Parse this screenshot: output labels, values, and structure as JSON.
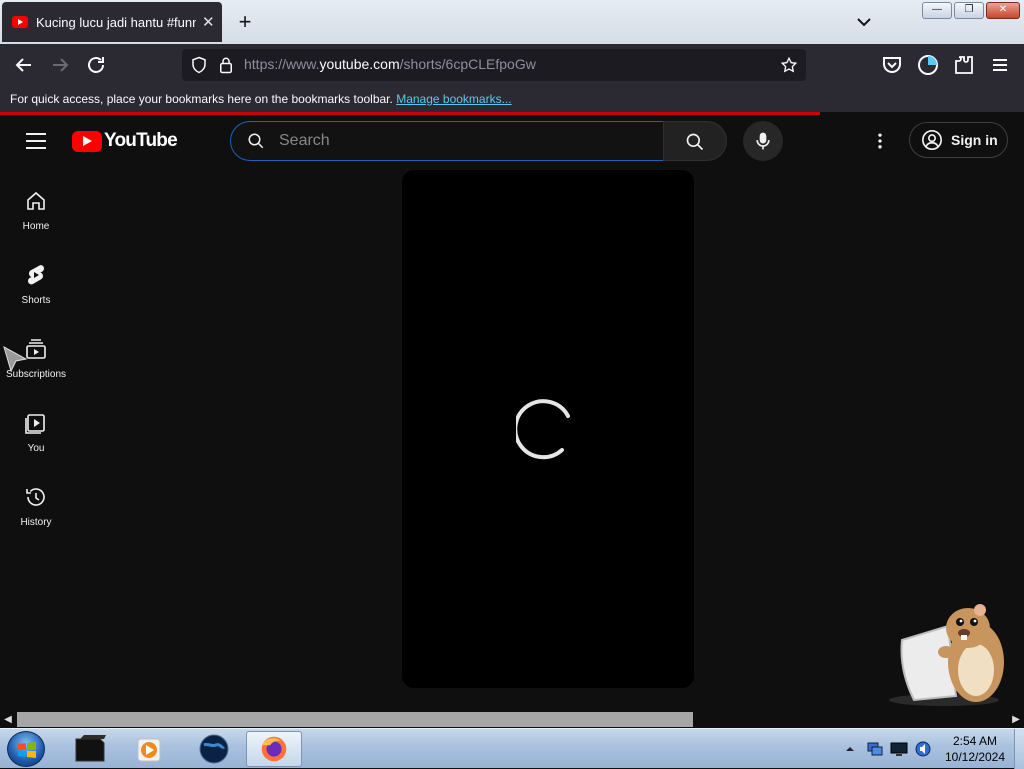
{
  "browser": {
    "tab": {
      "title": "Kucing lucu jadi hantu #funny"
    },
    "window_buttons": {
      "minimize": "—",
      "restore": "❐",
      "close": "✕"
    },
    "url": {
      "prefix": "https://www.",
      "host": "youtube.com",
      "path": "/shorts/6cpCLEfpoGw"
    },
    "bookmarks_bar": {
      "message": "For quick access, place your bookmarks here on the bookmarks toolbar.",
      "link": "Manage bookmarks..."
    }
  },
  "youtube": {
    "logo_text": "YouTube",
    "search": {
      "placeholder": "Search"
    },
    "signin_label": "Sign in",
    "sidebar": {
      "items": [
        {
          "label": "Home",
          "icon": "home-icon"
        },
        {
          "label": "Shorts",
          "icon": "shorts-icon"
        },
        {
          "label": "Subscriptions",
          "icon": "subscriptions-icon"
        },
        {
          "label": "You",
          "icon": "you-icon"
        },
        {
          "label": "History",
          "icon": "history-icon"
        }
      ]
    }
  },
  "taskbar": {
    "apps": [
      "media-center-icon",
      "media-player-icon",
      "globe-icon",
      "firefox-icon"
    ],
    "clock": {
      "time": "2:54 AM",
      "date": "10/12/2024"
    }
  },
  "colors": {
    "accent": "#ff0000",
    "loadbar": "#cc0000",
    "link": "#5bc8f5",
    "search_focus": "#1c62b9"
  }
}
